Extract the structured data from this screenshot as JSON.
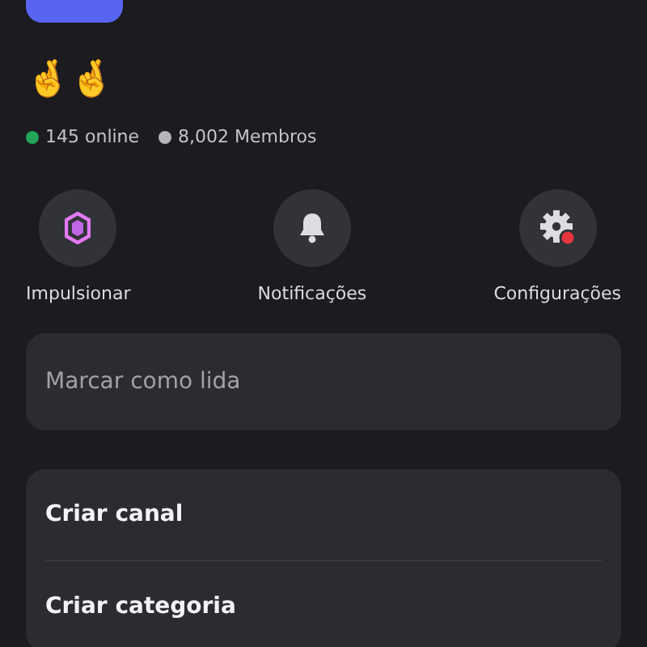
{
  "description": "🤞🤞",
  "stats": [
    {
      "label": "145 online",
      "color": "#23a55a"
    },
    {
      "label": "8,002 Membros",
      "color": "#b5b6bc"
    }
  ],
  "actions": [
    {
      "kind": "boost",
      "label": "Impulsionar"
    },
    {
      "kind": "bell",
      "label": "Notificações"
    },
    {
      "kind": "gear",
      "label": "Configurações",
      "badge": true
    }
  ],
  "mark_read": {
    "label": "Marcar como lida"
  },
  "menu": [
    {
      "label": "Criar canal"
    },
    {
      "label": "Criar categoria"
    }
  ]
}
